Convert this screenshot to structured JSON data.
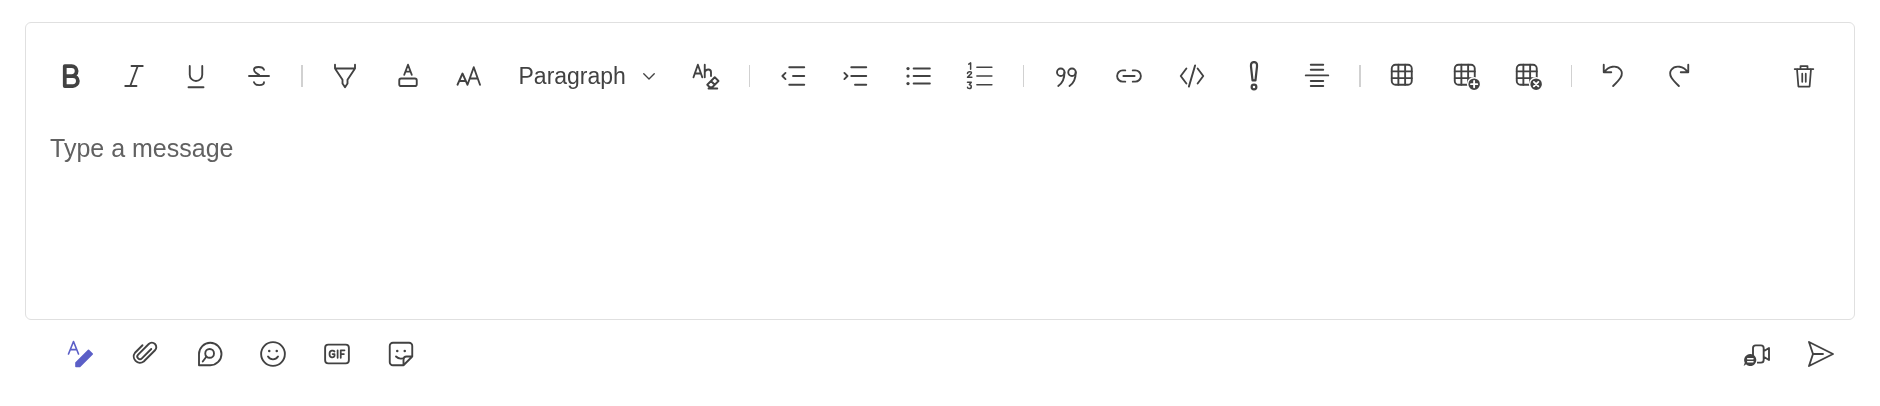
{
  "toolbar": {
    "style_dropdown": {
      "value": "Paragraph"
    }
  },
  "message": {
    "placeholder": "Type a message"
  },
  "format_button": {
    "on": true
  }
}
